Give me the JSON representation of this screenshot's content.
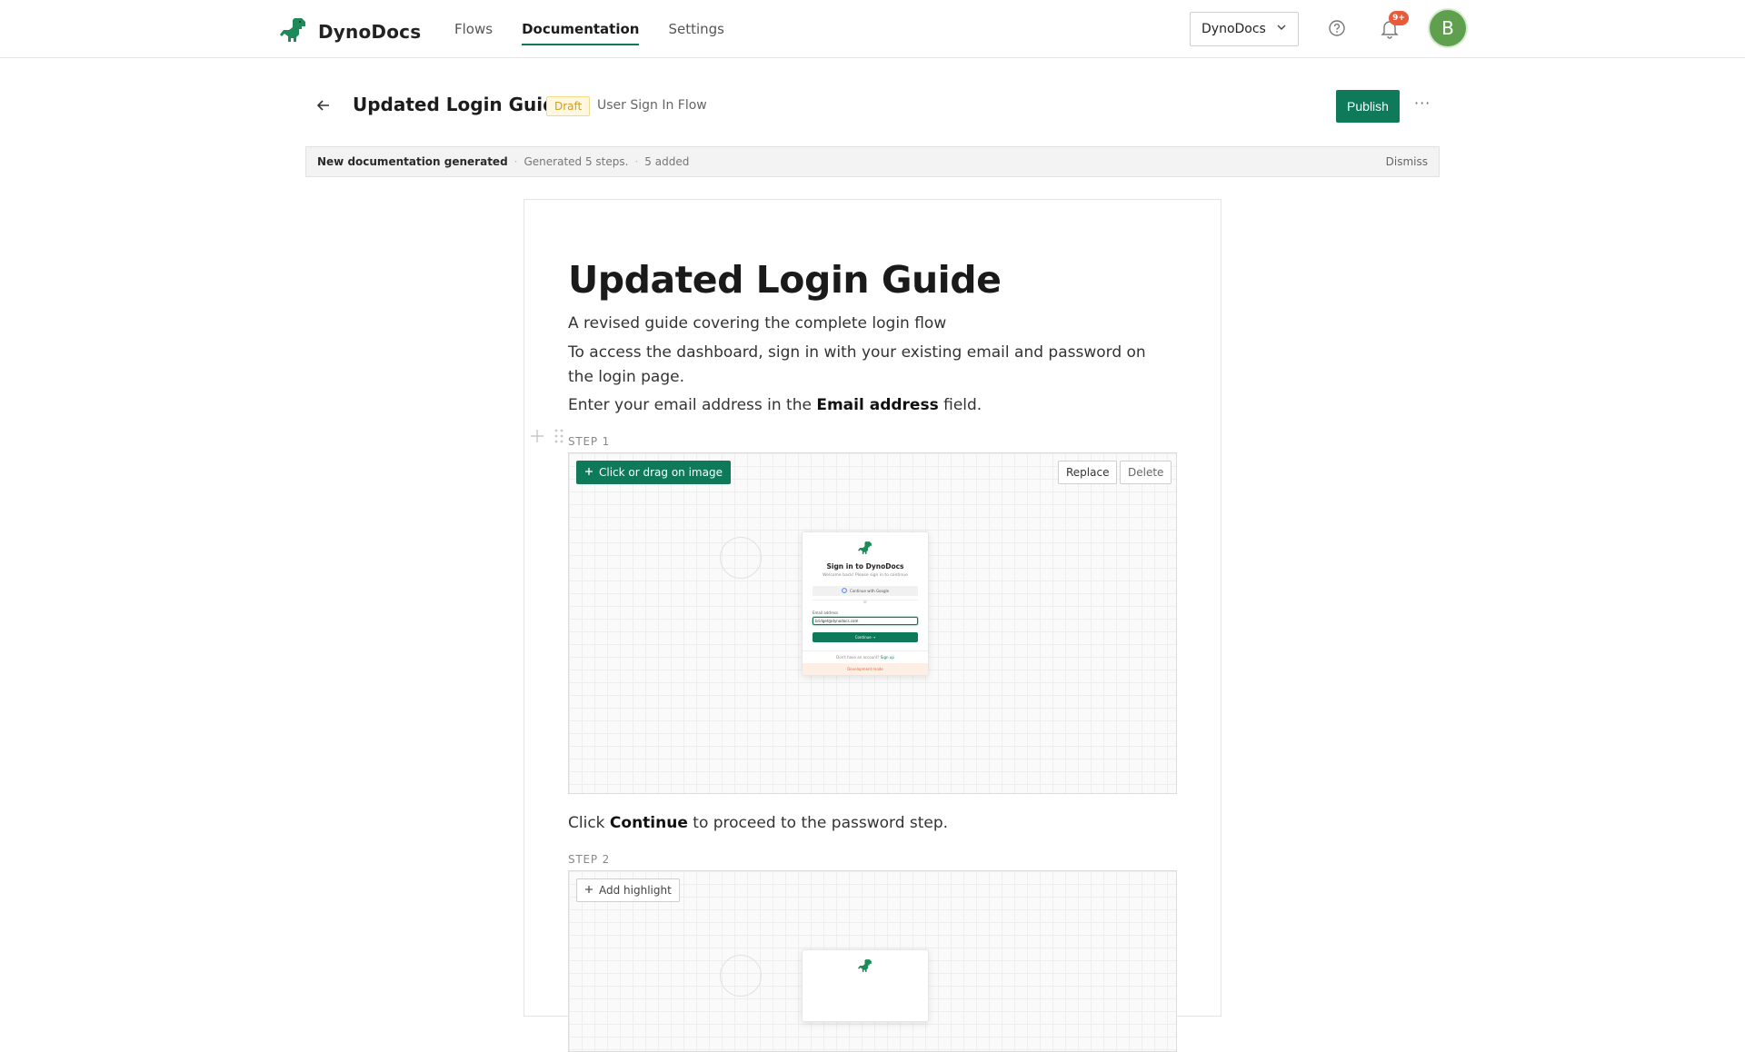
{
  "header": {
    "brand": "DynoDocs",
    "nav": [
      "Flows",
      "Documentation",
      "Settings"
    ],
    "active_nav": "Documentation",
    "workspace": "DynoDocs",
    "notifications_badge": "9+",
    "avatar_initial": "B"
  },
  "page": {
    "title": "Updated Login Guide",
    "status": "Draft",
    "flow_name": "User Sign In Flow",
    "publish_label": "Publish",
    "more_label": "···"
  },
  "notice": {
    "title": "New documentation generated",
    "detail": "Generated 5 steps.",
    "added": "5 added",
    "separator": "·",
    "dismiss": "Dismiss"
  },
  "doc": {
    "heading": "Updated Login Guide",
    "subtitle": "A revised guide covering the complete login flow",
    "intro": "To access the dashboard, sign in with your existing email and password on the login page.",
    "step1_text_before": "Enter your email address in the ",
    "step1_text_bold": "Email address",
    "step1_text_after": " field.",
    "step1_label": "STEP 1",
    "step1_tool": "Click or drag on image",
    "replace_label": "Replace",
    "delete_label": "Delete",
    "step2_text_before": "Click ",
    "step2_text_bold": "Continue",
    "step2_text_after": " to proceed to the password step.",
    "step2_label": "STEP 2",
    "step2_tool": "Add highlight"
  },
  "mini_login": {
    "title": "Sign in to DynoDocs",
    "subtitle": "Welcome back! Please sign in to continue",
    "google": "Continue with Google",
    "or": "or",
    "email_label": "Email address",
    "email_value": "bridget@dynodocs.com",
    "continue": "Continue →",
    "no_account": "Don't have an account?",
    "sign_up": "Sign up",
    "dev_mode": "Development mode"
  },
  "colors": {
    "accent": "#0f7a5a",
    "draft": "#d79c1a",
    "badge": "#e85a3a",
    "avatar": "#5fa04e"
  },
  "icons": [
    "dino-logo-icon",
    "chevron-down-icon",
    "help-icon",
    "bell-icon",
    "back-arrow-icon",
    "plus-icon",
    "drag-handle-icon",
    "google-icon"
  ]
}
